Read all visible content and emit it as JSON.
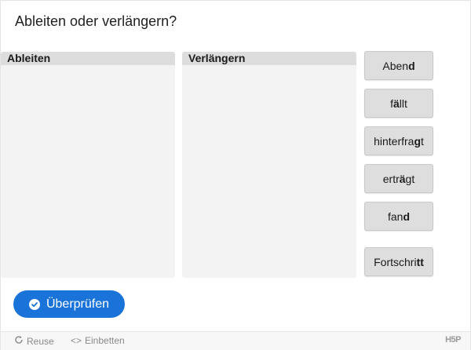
{
  "question": "Ableiten oder verlängern?",
  "dropzones": [
    {
      "label": "Ableiten"
    },
    {
      "label": "Verlängern"
    }
  ],
  "words": [
    {
      "prefix": "Aben",
      "bold": "d",
      "suffix": ""
    },
    {
      "prefix": "f",
      "bold": "ä",
      "suffix": "llt"
    },
    {
      "prefix": "hinterfra",
      "bold": "g",
      "suffix": "t"
    },
    {
      "prefix": "ertr",
      "bold": "ä",
      "suffix": "gt"
    },
    {
      "prefix": "fan",
      "bold": "d",
      "suffix": ""
    },
    {
      "prefix": "Fortschri",
      "bold": "tt",
      "suffix": ""
    }
  ],
  "check_button": {
    "label": "Überprüfen"
  },
  "footer": {
    "reuse": "Reuse",
    "embed": "Einbetten",
    "logo": "H5P"
  },
  "colors": {
    "primary": "#1a73d9",
    "dropzone_bg": "#f3f3f3",
    "dropzone_header": "#dddddd",
    "word_bg": "#dedede"
  }
}
